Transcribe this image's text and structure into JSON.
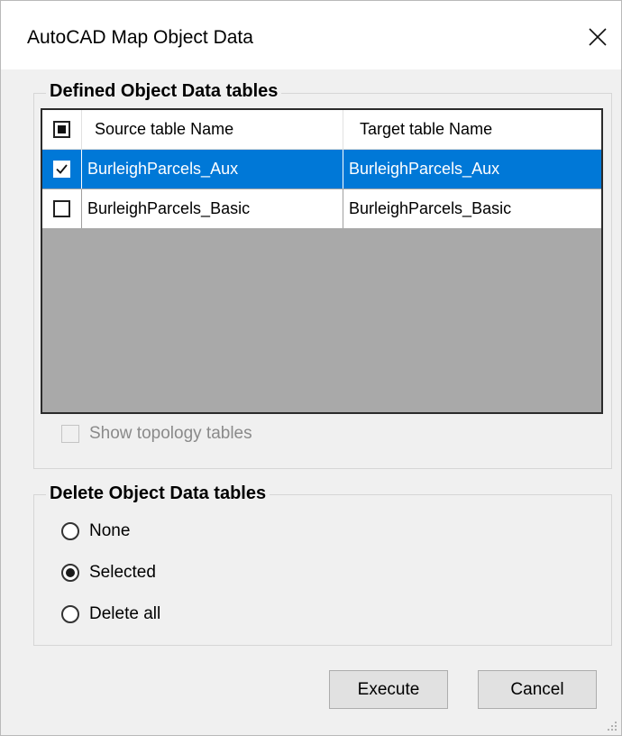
{
  "window": {
    "title": "AutoCAD Map Object Data"
  },
  "defined_group": {
    "title": "Defined Object Data tables"
  },
  "table": {
    "columns": [
      "Source table Name",
      "Target table Name"
    ],
    "rows": [
      {
        "source": "BurleighParcels_Aux",
        "target": "BurleighParcels_Aux",
        "checked": true,
        "selected": true
      },
      {
        "source": "BurleighParcels_Basic",
        "target": "BurleighParcels_Basic",
        "checked": false,
        "selected": false
      }
    ]
  },
  "show_topology": {
    "label": "Show topology tables",
    "checked": false,
    "enabled": false
  },
  "delete_group": {
    "title": "Delete Object Data tables",
    "options": [
      {
        "label": "None",
        "selected": false
      },
      {
        "label": "Selected",
        "selected": true
      },
      {
        "label": "Delete all",
        "selected": false
      }
    ]
  },
  "buttons": {
    "execute": "Execute",
    "cancel": "Cancel"
  },
  "colors": {
    "selection": "#0078d7",
    "grid_background": "#a9a9a9",
    "dialog_background": "#f0f0f0"
  }
}
